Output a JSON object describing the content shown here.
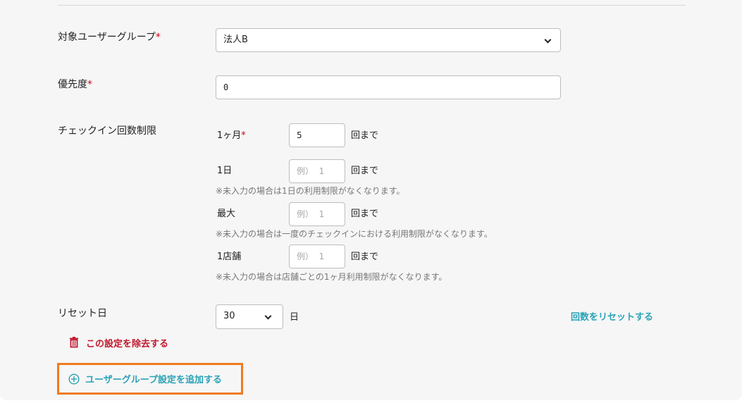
{
  "target_group": {
    "label": "対象ユーザーグループ",
    "required_mark": "*",
    "selected": "法人B"
  },
  "priority": {
    "label": "優先度",
    "required_mark": "*",
    "value": "0"
  },
  "checkin_limit": {
    "label": "チェックイン回数制限",
    "monthly": {
      "label": "1ヶ月",
      "required_mark": "*",
      "value": "5",
      "unit": "回まで"
    },
    "daily": {
      "label": "1日",
      "placeholder": "例）  1",
      "unit": "回まで",
      "note": "※未入力の場合は1日の利用制限がなくなります。"
    },
    "max": {
      "label": "最大",
      "placeholder": "例）  1",
      "unit": "回まで",
      "note": "※未入力の場合は一度のチェックインにおける利用制限がなくなります。"
    },
    "per_store": {
      "label": "1店舗",
      "placeholder": "例）  1",
      "unit": "回まで",
      "note": "※未入力の場合は店舗ごとの1ヶ月利用制限がなくなります。"
    }
  },
  "reset_day": {
    "label": "リセット日",
    "selected": "30",
    "unit": "日",
    "reset_link": "回数をリセットする"
  },
  "remove_setting": {
    "label": "この設定を除去する",
    "icon": "trash-icon"
  },
  "add_group": {
    "label": "ユーザーグループ設定を追加する",
    "icon": "plus-circle-icon"
  },
  "colors": {
    "required": "#d0021b",
    "link": "#2aa2b6",
    "danger": "#c0182d",
    "highlight": "#f07a1f"
  }
}
